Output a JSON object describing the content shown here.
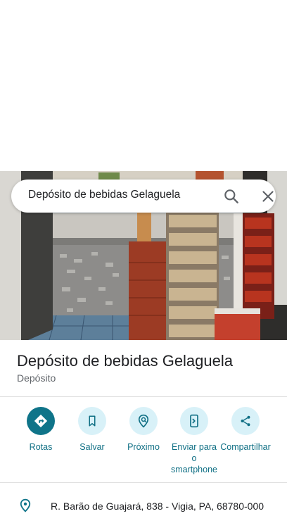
{
  "search": {
    "query": "Depósito de bebidas Gelaguela"
  },
  "place": {
    "name": "Depósito de bebidas Gelaguela",
    "category": "Depósito"
  },
  "actions": [
    {
      "label": "Rotas",
      "icon": "directions-icon"
    },
    {
      "label": "Salvar",
      "icon": "bookmark-icon"
    },
    {
      "label": "Próximo",
      "icon": "nearby-icon"
    },
    {
      "label": "Enviar para o smartphone",
      "icon": "send-to-phone-icon"
    },
    {
      "label": "Compartilhar",
      "icon": "share-icon"
    }
  ],
  "address": {
    "text": "R. Barão de Guajará, 838 - Vigia, PA, 68780-000"
  },
  "colors": {
    "accent": "#0f7489",
    "accent_light": "#d8f1f8",
    "label": "#0f6f84"
  }
}
